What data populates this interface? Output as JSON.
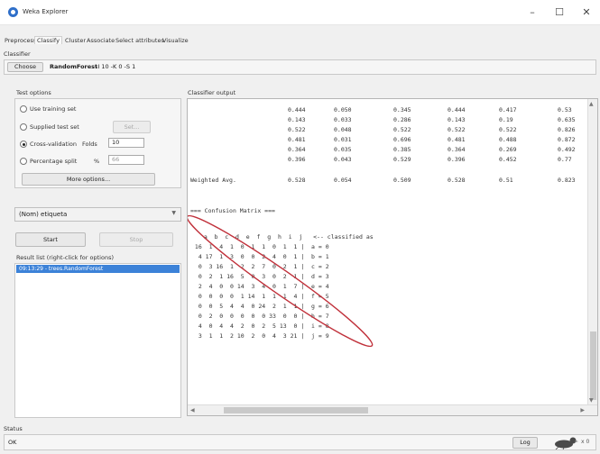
{
  "window": {
    "title": "Weka Explorer",
    "minimize": "–",
    "maximize": "☐",
    "close": "✕"
  },
  "tabs": [
    "Preprocess",
    "Classify",
    "Cluster",
    "Associate",
    "Select attributes",
    "Visualize"
  ],
  "classifier": {
    "section_label": "Classifier",
    "choose_label": "Choose",
    "name": "RandomForest",
    "options": "-I 10 -K 0 -S 1"
  },
  "test_options": {
    "title": "Test options",
    "use_training": "Use training set",
    "supplied_test": "Supplied test set",
    "set_button": "Set...",
    "cross_validation": "Cross-validation",
    "folds_label": "Folds",
    "folds_value": "10",
    "percentage_split": "Percentage split",
    "percent_symbol": "%",
    "percent_value": "66",
    "more_options": "More options..."
  },
  "class_select": {
    "value": "(Nom) etiqueta"
  },
  "run": {
    "start": "Start",
    "stop": "Stop"
  },
  "result_list": {
    "title": "Result list (right-click for options)",
    "items": [
      "09:13:29 - trees.RandomForest"
    ]
  },
  "output": {
    "title": "Classifier output",
    "accuracy_rows": [
      [
        "0.444",
        "0.050",
        "0.345",
        "0.444",
        "0.417",
        "0.53"
      ],
      [
        "0.143",
        "0.033",
        "0.286",
        "0.143",
        "0.19",
        "0.635"
      ],
      [
        "0.522",
        "0.048",
        "0.522",
        "0.522",
        "0.522",
        "0.826"
      ],
      [
        "0.481",
        "0.031",
        "0.696",
        "0.481",
        "0.488",
        "0.872"
      ],
      [
        "0.364",
        "0.035",
        "0.385",
        "0.364",
        "0.269",
        "0.492"
      ],
      [
        "0.396",
        "0.043",
        "0.529",
        "0.396",
        "0.452",
        "0.77"
      ]
    ],
    "weighted_label": "Weighted Avg.",
    "weighted_row": [
      "0.528",
      "0.054",
      "0.509",
      "0.528",
      "0.51",
      "0.823"
    ],
    "confusion_title": "=== Confusion Matrix ===",
    "matrix_header": "  a  b  c  d  e  f  g  h  i  j   <-- classified as",
    "matrix_rows": [
      " 16  1  4  1  0  1  1  0  1  1 |  a = 0",
      "  4 17  1  3  0  0  2  4  0  1 |  b = 1",
      "  0  3 16  1  2  2  7  0  2  1 |  c = 2",
      "  0  2  1 16  5  0  3  0  2  1 |  d = 3",
      "  2  4  0  0 14  3  4  0  1  7 |  e = 4",
      "  0  0  0  0  1 14  1  1  1  4 |  f = 5",
      "  0  0  5  4  4  0 24  2  1  1 |  g = 6",
      "  0  2  0  0  0  0  0 33  0  0 |  h = 7",
      "  4  0  4  4  2  0  2  5 13  0 |  i = 8",
      "  3  1  1  2 10  2  0  4  3 21 |  j = 9"
    ]
  },
  "status": {
    "label": "Status",
    "text": "OK",
    "log_button": "Log",
    "x_count": "x 0"
  }
}
